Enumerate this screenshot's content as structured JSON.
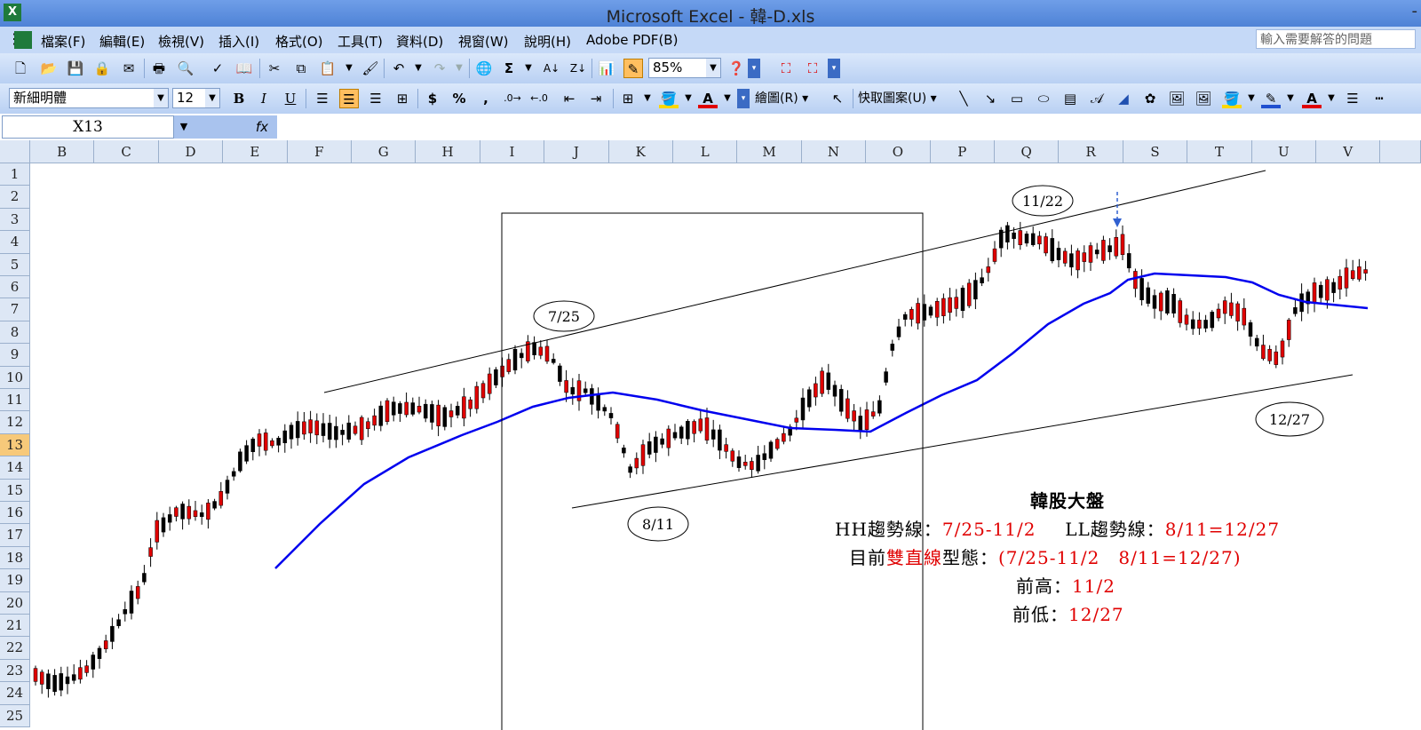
{
  "window": {
    "title": "Microsoft Excel - 韓-D.xls",
    "icon": "excel-icon",
    "minimize_glyph": "-"
  },
  "menu": {
    "items": [
      "檔案(F)",
      "編輯(E)",
      "檢視(V)",
      "插入(I)",
      "格式(O)",
      "工具(T)",
      "資料(D)",
      "視窗(W)",
      "說明(H)",
      "Adobe PDF(B)"
    ],
    "help_placeholder": "輸入需要解答的問題"
  },
  "standard_toolbar": {
    "zoom": "85%"
  },
  "format_toolbar": {
    "font": "新細明體",
    "size": "12",
    "bold": "B",
    "italic": "I",
    "underline": "U",
    "currency": "$",
    "percent": "%",
    "comma": ",",
    "draw_label": "繪圖(R)",
    "autoshape_label": "快取圖案(U)"
  },
  "formula_bar": {
    "name_box": "X13",
    "fx": "fx",
    "value": ""
  },
  "columns": [
    "B",
    "C",
    "D",
    "E",
    "F",
    "G",
    "H",
    "I",
    "J",
    "K",
    "L",
    "M",
    "N",
    "O",
    "P",
    "Q",
    "R",
    "S",
    "T",
    "U",
    "V"
  ],
  "rows": [
    "1",
    "2",
    "3",
    "4",
    "5",
    "6",
    "7",
    "8",
    "9",
    "10",
    "11",
    "12",
    "13",
    "14",
    "15",
    "16",
    "17",
    "18",
    "19",
    "20",
    "21",
    "22",
    "23",
    "24",
    "25"
  ],
  "selected_row": "13",
  "colors": {
    "up": "#e00000",
    "down": "#000000",
    "ma": "#0000ee",
    "trend": "#000000",
    "annotation_red": "#e00000"
  },
  "chart_data": {
    "type": "candlestick",
    "series": [
      {
        "name": "",
        "kind": "ohlc"
      },
      {
        "name": "",
        "kind": "moving-average"
      }
    ],
    "labels": [
      "7/25",
      "11/22",
      "8/11",
      "12/27"
    ],
    "trendlines": [
      "HH: 7/25-11/2",
      "LL: 8/11-12/27"
    ]
  },
  "annotation": {
    "title": "韓股大盤",
    "line1_label": "HH趨勢線：",
    "line1_value": "7/25-11/2",
    "line1_label2": "LL趨勢線：",
    "line1_value2": "8/11=12/27",
    "line2_prefix": "目前",
    "line2_red": "雙直線",
    "line2_mid": "型態：",
    "line2_value": "(7/25-11/2　8/11=12/27)",
    "line3_label": "前高：",
    "line3_value": "11/2",
    "line4_label": "前低：",
    "line4_value": "12/27"
  }
}
